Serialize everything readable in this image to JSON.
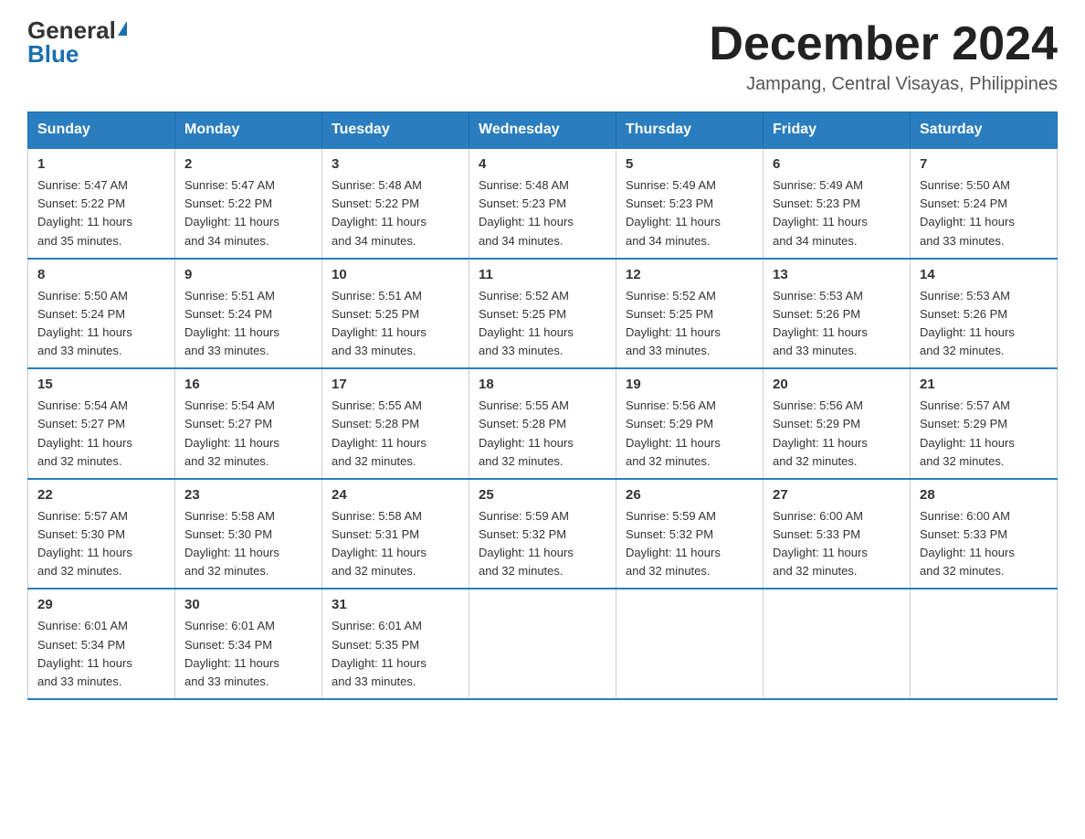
{
  "header": {
    "logo_general": "General",
    "logo_blue": "Blue",
    "month_title": "December 2024",
    "location": "Jampang, Central Visayas, Philippines"
  },
  "days_of_week": [
    "Sunday",
    "Monday",
    "Tuesday",
    "Wednesday",
    "Thursday",
    "Friday",
    "Saturday"
  ],
  "weeks": [
    [
      {
        "day": "1",
        "sunrise": "5:47 AM",
        "sunset": "5:22 PM",
        "daylight": "11 hours and 35 minutes."
      },
      {
        "day": "2",
        "sunrise": "5:47 AM",
        "sunset": "5:22 PM",
        "daylight": "11 hours and 34 minutes."
      },
      {
        "day": "3",
        "sunrise": "5:48 AM",
        "sunset": "5:22 PM",
        "daylight": "11 hours and 34 minutes."
      },
      {
        "day": "4",
        "sunrise": "5:48 AM",
        "sunset": "5:23 PM",
        "daylight": "11 hours and 34 minutes."
      },
      {
        "day": "5",
        "sunrise": "5:49 AM",
        "sunset": "5:23 PM",
        "daylight": "11 hours and 34 minutes."
      },
      {
        "day": "6",
        "sunrise": "5:49 AM",
        "sunset": "5:23 PM",
        "daylight": "11 hours and 34 minutes."
      },
      {
        "day": "7",
        "sunrise": "5:50 AM",
        "sunset": "5:24 PM",
        "daylight": "11 hours and 33 minutes."
      }
    ],
    [
      {
        "day": "8",
        "sunrise": "5:50 AM",
        "sunset": "5:24 PM",
        "daylight": "11 hours and 33 minutes."
      },
      {
        "day": "9",
        "sunrise": "5:51 AM",
        "sunset": "5:24 PM",
        "daylight": "11 hours and 33 minutes."
      },
      {
        "day": "10",
        "sunrise": "5:51 AM",
        "sunset": "5:25 PM",
        "daylight": "11 hours and 33 minutes."
      },
      {
        "day": "11",
        "sunrise": "5:52 AM",
        "sunset": "5:25 PM",
        "daylight": "11 hours and 33 minutes."
      },
      {
        "day": "12",
        "sunrise": "5:52 AM",
        "sunset": "5:25 PM",
        "daylight": "11 hours and 33 minutes."
      },
      {
        "day": "13",
        "sunrise": "5:53 AM",
        "sunset": "5:26 PM",
        "daylight": "11 hours and 33 minutes."
      },
      {
        "day": "14",
        "sunrise": "5:53 AM",
        "sunset": "5:26 PM",
        "daylight": "11 hours and 32 minutes."
      }
    ],
    [
      {
        "day": "15",
        "sunrise": "5:54 AM",
        "sunset": "5:27 PM",
        "daylight": "11 hours and 32 minutes."
      },
      {
        "day": "16",
        "sunrise": "5:54 AM",
        "sunset": "5:27 PM",
        "daylight": "11 hours and 32 minutes."
      },
      {
        "day": "17",
        "sunrise": "5:55 AM",
        "sunset": "5:28 PM",
        "daylight": "11 hours and 32 minutes."
      },
      {
        "day": "18",
        "sunrise": "5:55 AM",
        "sunset": "5:28 PM",
        "daylight": "11 hours and 32 minutes."
      },
      {
        "day": "19",
        "sunrise": "5:56 AM",
        "sunset": "5:29 PM",
        "daylight": "11 hours and 32 minutes."
      },
      {
        "day": "20",
        "sunrise": "5:56 AM",
        "sunset": "5:29 PM",
        "daylight": "11 hours and 32 minutes."
      },
      {
        "day": "21",
        "sunrise": "5:57 AM",
        "sunset": "5:29 PM",
        "daylight": "11 hours and 32 minutes."
      }
    ],
    [
      {
        "day": "22",
        "sunrise": "5:57 AM",
        "sunset": "5:30 PM",
        "daylight": "11 hours and 32 minutes."
      },
      {
        "day": "23",
        "sunrise": "5:58 AM",
        "sunset": "5:30 PM",
        "daylight": "11 hours and 32 minutes."
      },
      {
        "day": "24",
        "sunrise": "5:58 AM",
        "sunset": "5:31 PM",
        "daylight": "11 hours and 32 minutes."
      },
      {
        "day": "25",
        "sunrise": "5:59 AM",
        "sunset": "5:32 PM",
        "daylight": "11 hours and 32 minutes."
      },
      {
        "day": "26",
        "sunrise": "5:59 AM",
        "sunset": "5:32 PM",
        "daylight": "11 hours and 32 minutes."
      },
      {
        "day": "27",
        "sunrise": "6:00 AM",
        "sunset": "5:33 PM",
        "daylight": "11 hours and 32 minutes."
      },
      {
        "day": "28",
        "sunrise": "6:00 AM",
        "sunset": "5:33 PM",
        "daylight": "11 hours and 32 minutes."
      }
    ],
    [
      {
        "day": "29",
        "sunrise": "6:01 AM",
        "sunset": "5:34 PM",
        "daylight": "11 hours and 33 minutes."
      },
      {
        "day": "30",
        "sunrise": "6:01 AM",
        "sunset": "5:34 PM",
        "daylight": "11 hours and 33 minutes."
      },
      {
        "day": "31",
        "sunrise": "6:01 AM",
        "sunset": "5:35 PM",
        "daylight": "11 hours and 33 minutes."
      },
      null,
      null,
      null,
      null
    ]
  ],
  "labels": {
    "sunrise": "Sunrise:",
    "sunset": "Sunset:",
    "daylight": "Daylight:"
  }
}
